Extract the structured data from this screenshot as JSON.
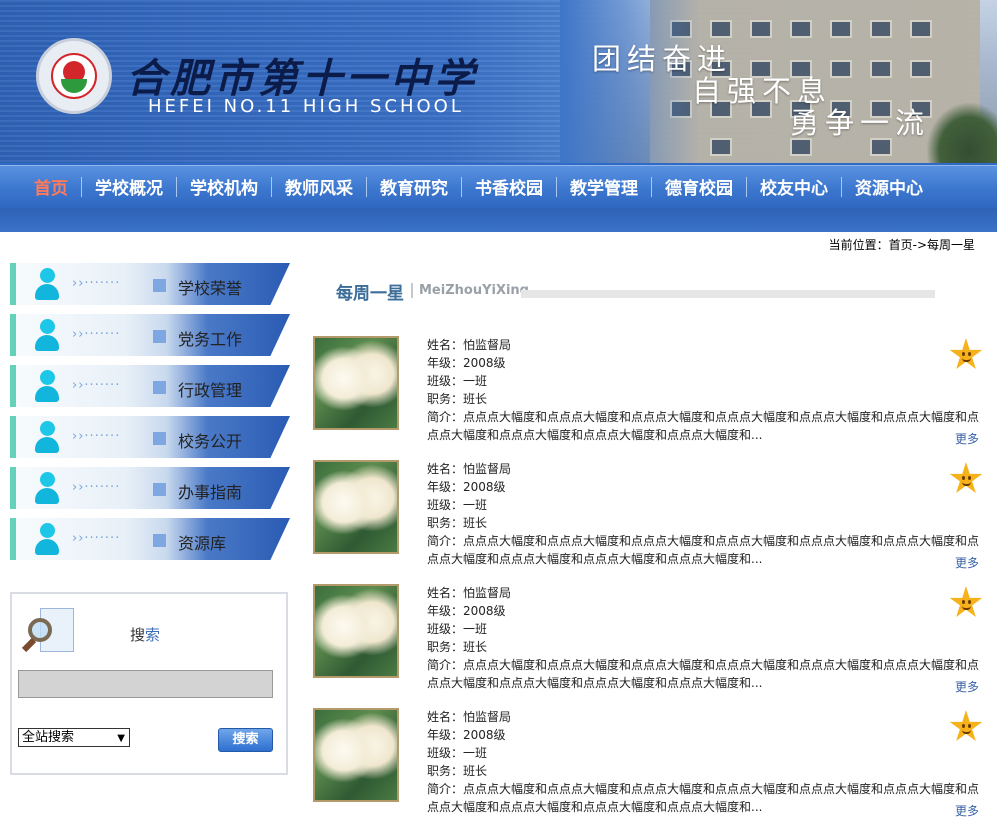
{
  "header": {
    "school_name_cn": "合肥市第十一中学",
    "school_name_en": "HEFEI NO.11 HIGH SCHOOL",
    "motto": [
      "团结奋进",
      "自强不息",
      "勇争一流"
    ]
  },
  "nav": {
    "items": [
      {
        "label": "首页"
      },
      {
        "label": "学校概况"
      },
      {
        "label": "学校机构"
      },
      {
        "label": "教师风采"
      },
      {
        "label": "教育研究"
      },
      {
        "label": "书香校园"
      },
      {
        "label": "教学管理"
      },
      {
        "label": "德育校园"
      },
      {
        "label": "校友中心"
      },
      {
        "label": "资源中心"
      }
    ],
    "active_index": 0
  },
  "breadcrumb": "当前位置：首页->每周一星",
  "sidebar": {
    "items": [
      {
        "label": "学校荣誉"
      },
      {
        "label": "党务工作"
      },
      {
        "label": "行政管理"
      },
      {
        "label": "校务公开"
      },
      {
        "label": "办事指南"
      },
      {
        "label": "资源库"
      }
    ],
    "dots": "››·······"
  },
  "search": {
    "title_a": "搜",
    "title_b": "索",
    "input_value": "",
    "select_value": "全站搜索",
    "button_label": "搜索"
  },
  "section": {
    "title": "每周一星",
    "subtitle": "MeiZhouYiXing"
  },
  "entries": [
    {
      "name": "姓名：怕监督局",
      "grade": "年级：2008级",
      "class": "班级：一班",
      "role": "职务：班长",
      "intro": "简介：点点点大幅度和点点点大幅度和点点点大幅度和点点点大幅度和点点点大幅度和点点点大幅度和点点点大幅度和点点点大幅度和点点点大幅度和点点点大幅度和...",
      "more": "更多"
    },
    {
      "name": "姓名：怕监督局",
      "grade": "年级：2008级",
      "class": "班级：一班",
      "role": "职务：班长",
      "intro": "简介：点点点大幅度和点点点大幅度和点点点大幅度和点点点大幅度和点点点大幅度和点点点大幅度和点点点大幅度和点点点大幅度和点点点大幅度和点点点大幅度和...",
      "more": "更多"
    },
    {
      "name": "姓名：怕监督局",
      "grade": "年级：2008级",
      "class": "班级：一班",
      "role": "职务：班长",
      "intro": "简介：点点点大幅度和点点点大幅度和点点点大幅度和点点点大幅度和点点点大幅度和点点点大幅度和点点点大幅度和点点点大幅度和点点点大幅度和点点点大幅度和...",
      "more": "更多"
    },
    {
      "name": "姓名：怕监督局",
      "grade": "年级：2008级",
      "class": "班级：一班",
      "role": "职务：班长",
      "intro": "简介：点点点大幅度和点点点大幅度和点点点大幅度和点点点大幅度和点点点大幅度和点点点大幅度和点点点大幅度和点点点大幅度和点点点大幅度和点点点大幅度和...",
      "more": "更多"
    }
  ],
  "icons": {
    "logo": "school-emblem-icon",
    "sidebar_item": "person-icon",
    "search": "magnifier-document-icon",
    "entry_badge": "smiling-star-icon"
  },
  "colors": {
    "nav_blue": "#3c77cf",
    "active_nav": "#ff7a5a",
    "accent_green": "#63d2b8",
    "star": "#f6b21b",
    "link": "#3a62a8"
  }
}
